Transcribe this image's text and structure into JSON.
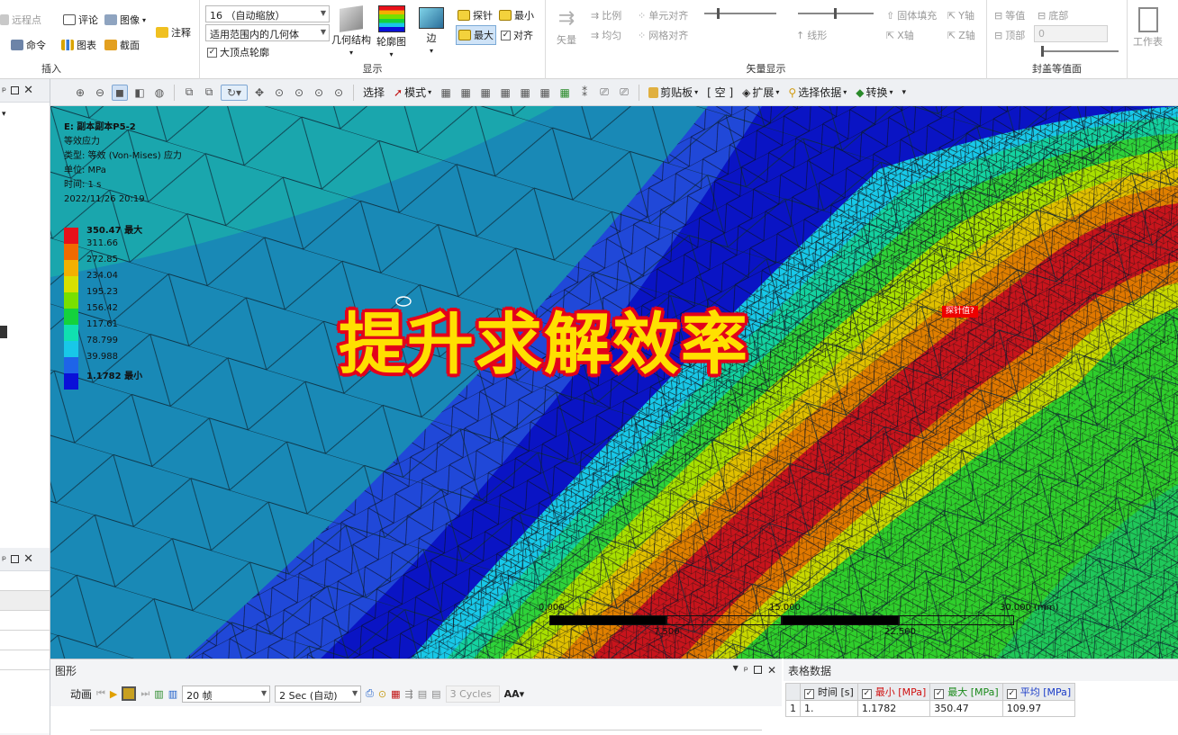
{
  "ribbon": {
    "insert": {
      "remote_point": "远程点",
      "comment": "评论",
      "image": "图像",
      "command": "命令",
      "chart": "图表",
      "section": "截面",
      "annotation": "注释",
      "group_label": "插入"
    },
    "display": {
      "scale_value": "16 （自动缩放）",
      "scope_value": "适用范围内的几何体",
      "max_vertex_label": "大顶点轮廓",
      "geometry_label": "几何结构",
      "contour_label": "轮廓图",
      "edge_label": "边",
      "probe_label": "探针",
      "min_label": "最小",
      "max_label": "最大",
      "align_label": "对齐",
      "group_label": "显示"
    },
    "vector": {
      "vector_label": "矢量",
      "proportional_label": "比例",
      "uniform_label": "均匀",
      "element_align_label": "单元对齐",
      "grid_align_label": "网格对齐",
      "line_label": "线形",
      "solid_fill_label": "固体填充",
      "x_axis_label": "X轴",
      "y_axis_label": "Y轴",
      "z_axis_label": "Z轴",
      "group_label": "矢量显示"
    },
    "capping": {
      "equal_label": "等值",
      "top_label": "顶部",
      "bottom_label": "底部",
      "value": "0",
      "group_label": "封盖等值面"
    },
    "worksheet_label": "工作表"
  },
  "toolbar": {
    "select_label": "选择",
    "mode_label": "模式",
    "clipboard_label": "剪贴板",
    "empty_label": "[ 空 ]",
    "expand_label": "扩展",
    "select_by_label": "选择依据",
    "convert_label": "转换"
  },
  "viewport": {
    "legend_header": [
      "E: 副本副本P5-2",
      "等效应力",
      "类型: 等效 (Von-Mises) 应力",
      "单位: MPa",
      "时间: 1 s",
      "2022/11/26 20:19"
    ],
    "legend_items": [
      {
        "label": "350.47 最大",
        "color": "#e8101a",
        "bold": true
      },
      {
        "label": "311.66",
        "color": "#f06a00",
        "bold": false
      },
      {
        "label": "272.85",
        "color": "#f2b000",
        "bold": false
      },
      {
        "label": "234.04",
        "color": "#d8e000",
        "bold": false
      },
      {
        "label": "195.23",
        "color": "#78e000",
        "bold": false
      },
      {
        "label": "156.42",
        "color": "#14d23c",
        "bold": false
      },
      {
        "label": "117.61",
        "color": "#10e0b0",
        "bold": false
      },
      {
        "label": "78.799",
        "color": "#18c8e8",
        "bold": false
      },
      {
        "label": "39.988",
        "color": "#1e64e8",
        "bold": false
      },
      {
        "label": "1.1782 最小",
        "color": "#0a10d8",
        "bold": true
      }
    ],
    "overlay_title": "提升求解效率",
    "probe_text": "探针值?",
    "scale_labels": [
      "0.000",
      "15.000",
      "30.000 (mm)",
      "7.500",
      "22.500"
    ]
  },
  "bottom": {
    "graph_title": "图形",
    "animation_label": "动画",
    "frames_value": "20 帧",
    "duration_value": "2 Sec (自动)",
    "cycles_value": "3 Cycles",
    "tabular_title": "表格数据",
    "table_headers": [
      "时间 [s]",
      "最小 [MPa]",
      "最大 [MPa]",
      "平均 [MPa]"
    ],
    "table_rows": [
      [
        "1",
        "1.",
        "1.1782",
        "350.47",
        "109.97"
      ]
    ]
  },
  "colors": {
    "ribbon_bg": "#ffffff",
    "toolbar_bg": "#eef0f3",
    "overlay_fill": "#ffe000",
    "overlay_stroke": "#e3001b",
    "stress_red": "#c8141c"
  }
}
